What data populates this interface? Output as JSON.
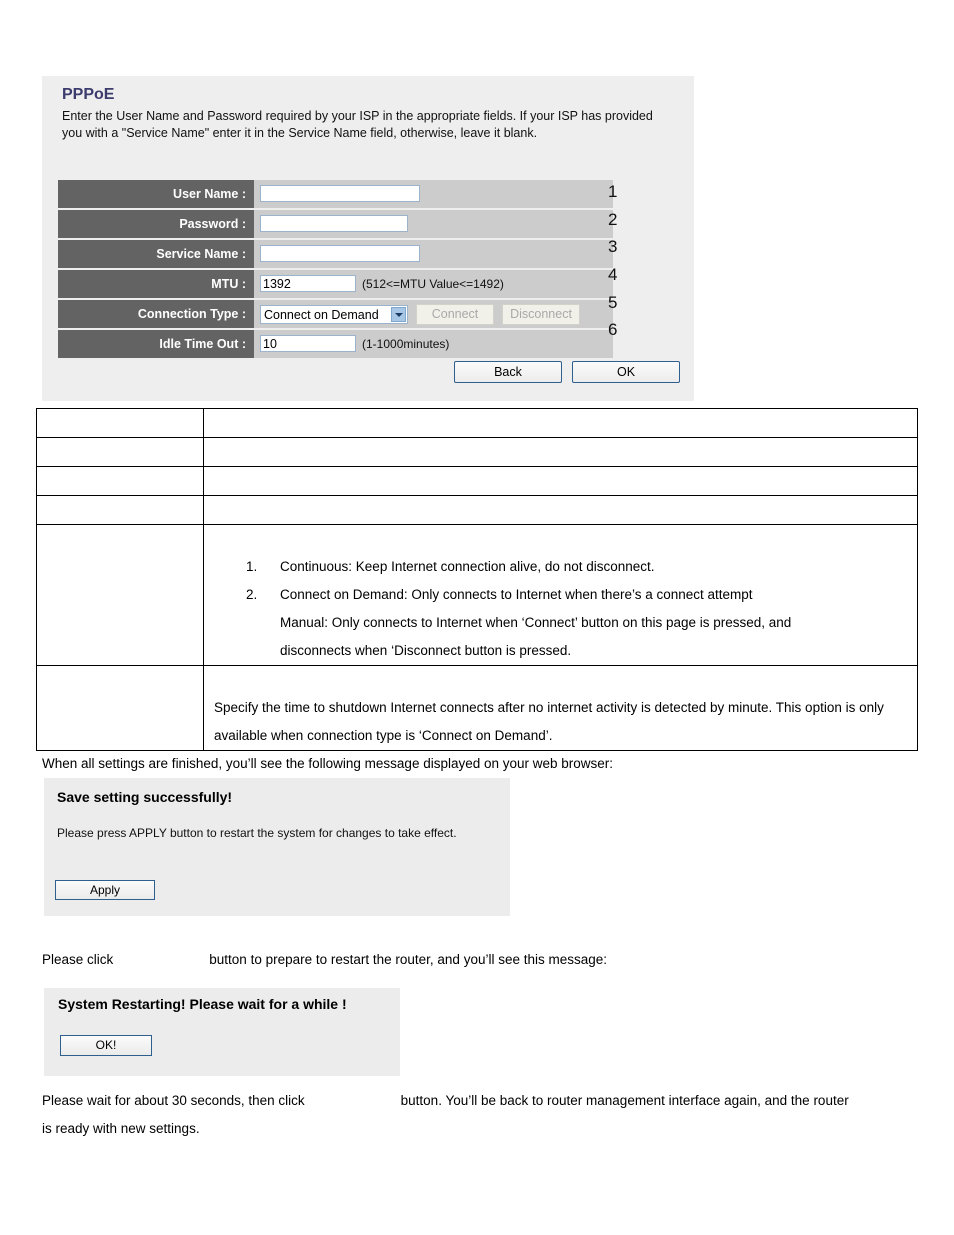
{
  "panel": {
    "title": "PPPoE",
    "description": "Enter the User Name and Password required by your ISP in the appropriate fields. If your ISP has provided you with a \"Service Name\" enter it in the Service Name field, otherwise, leave it blank.",
    "fields": [
      {
        "label": "User Name :",
        "value": "",
        "hint": "",
        "number": "1"
      },
      {
        "label": "Password :",
        "value": "",
        "hint": "",
        "number": "2"
      },
      {
        "label": "Service Name :",
        "value": "",
        "hint": "",
        "number": "3"
      },
      {
        "label": "MTU :",
        "value": "1392",
        "hint": "(512<=MTU Value<=1492)",
        "number": "4"
      },
      {
        "label": "Connection Type :",
        "value": "Connect on Demand",
        "hint": "",
        "number": "5"
      },
      {
        "label": "Idle Time Out :",
        "value": "10",
        "hint": "(1-1000minutes)",
        "number": "6"
      }
    ],
    "connection_type_selected": "Connect on Demand",
    "connect_button": "Connect",
    "disconnect_button": "Disconnect",
    "back_button": "Back",
    "ok_button": "OK",
    "numbers": [
      "1",
      "2",
      "3",
      "4",
      "5",
      "6"
    ]
  },
  "desc_table": {
    "rows": [
      {
        "label": "",
        "text": ""
      },
      {
        "label": "",
        "text": ""
      },
      {
        "label": "",
        "text": ""
      },
      {
        "label": "",
        "text": ""
      }
    ],
    "connection_type_row": {
      "label": "",
      "items": [
        {
          "num": "1.",
          "text": "Continuous: Keep Internet connection alive, do not disconnect."
        },
        {
          "num": "2.",
          "text": "Connect on Demand: Only connects to Internet when there’s a connect attempt"
        }
      ],
      "extra_lines": [
        "Manual: Only connects to Internet when ‘Connect’ button on this page is pressed, and",
        "disconnects when ‘Disconnect button is pressed."
      ]
    },
    "idle_row": {
      "label": "",
      "text": "Specify the time to shutdown Internet connects after no internet activity is detected by minute. This option is only available when connection type is ‘Connect on Demand’."
    }
  },
  "paragraphs": {
    "after_table": "When all settings are finished, you’ll see the following message displayed on your web browser:",
    "please_click_pre": "Please click",
    "please_click_post": "button to prepare to restart the router, and you’ll see this message:",
    "wait_pre": "Please wait for about 30 seconds, then click",
    "wait_post": "button. You’ll be back to router management interface again, and the router",
    "wait_line2": "is ready with new settings."
  },
  "save_box": {
    "heading": "Save setting successfully!",
    "body": "Please press APPLY button to restart the system for changes to take effect.",
    "apply_button": "Apply"
  },
  "restart_box": {
    "heading": "System Restarting! Please wait for a while !",
    "ok_button": "OK!"
  },
  "colors": {
    "panel_bg": "#eeeeee",
    "label_cell": "#636363",
    "value_cell": "#cccccc",
    "title": "#3b3b6d",
    "input_border": "#9bb3cc",
    "button_border": "#2f5f8f"
  }
}
